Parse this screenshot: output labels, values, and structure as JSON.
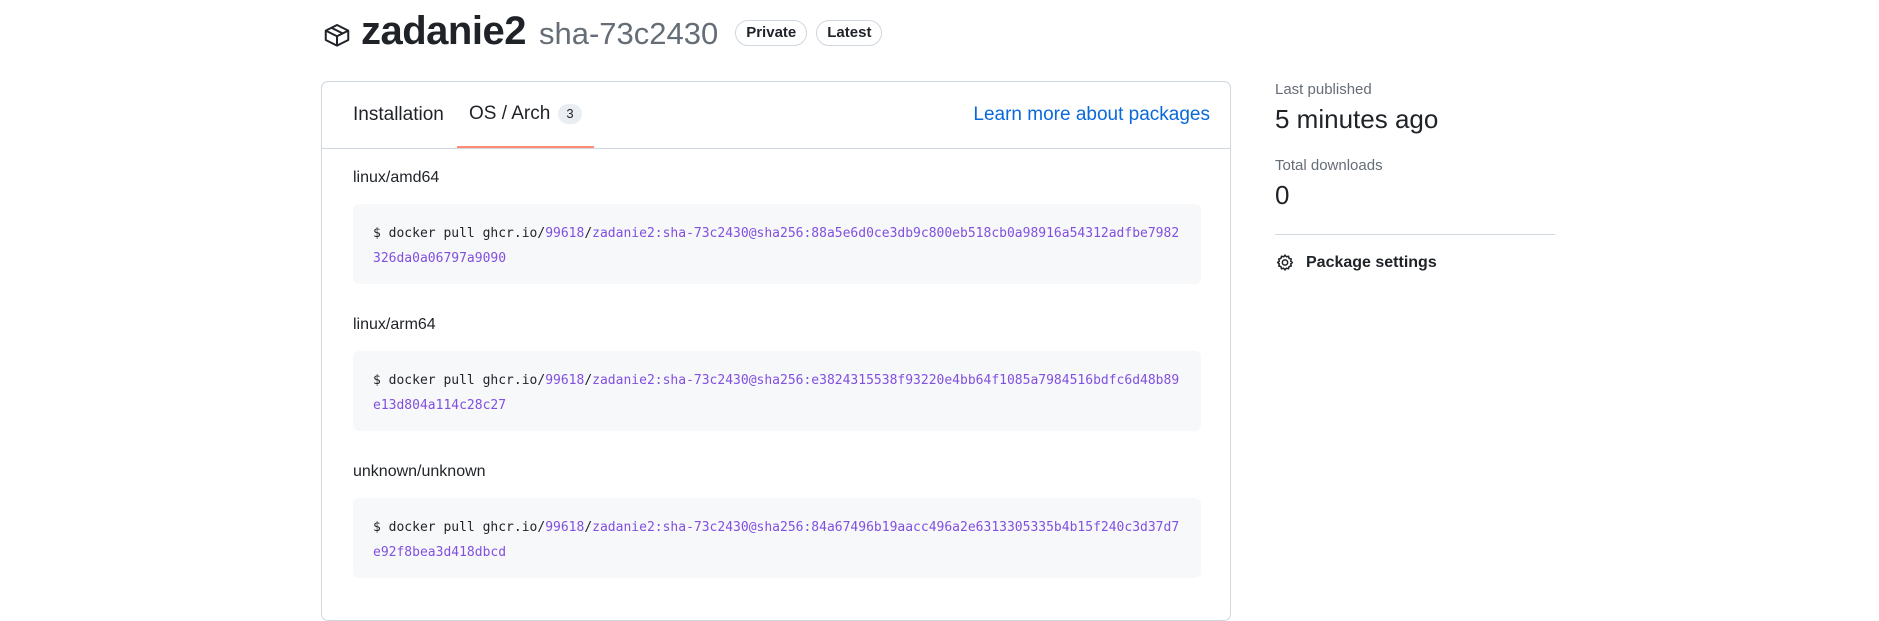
{
  "package": {
    "icon": "package-icon",
    "name": "zadanie2",
    "tag": "sha-73c2430",
    "badges": [
      "Private",
      "Latest"
    ]
  },
  "tabs": {
    "installation": "Installation",
    "os_arch": "OS / Arch",
    "os_arch_count": "3",
    "learn_more": "Learn more about packages"
  },
  "platforms": [
    {
      "label": "linux/amd64",
      "prefix": "$ docker pull ghcr.io/",
      "owner": "99618",
      "slash": "/",
      "image": "zadanie2:sha-73c2430@sha256:88a5e6d0ce3db9c800eb518cb0a98916a54312adfbe7982326da0a06797a9090"
    },
    {
      "label": "linux/arm64",
      "prefix": "$ docker pull ghcr.io/",
      "owner": "99618",
      "slash": "/",
      "image": "zadanie2:sha-73c2430@sha256:e3824315538f93220e4bb64f1085a7984516bdfc6d48b89e13d804a114c28c27"
    },
    {
      "label": "unknown/unknown",
      "prefix": "$ docker pull ghcr.io/",
      "owner": "99618",
      "slash": "/",
      "image": "zadanie2:sha-73c2430@sha256:84a67496b19aacc496a2e6313305335b4b15f240c3d37d7e92f8bea3d418dbcd"
    }
  ],
  "sidebar": {
    "last_published_label": "Last published",
    "last_published_value": "5 minutes ago",
    "total_downloads_label": "Total downloads",
    "total_downloads_value": "0",
    "settings_icon": "gear-icon",
    "settings_label": "Package settings"
  },
  "colors": {
    "accent_link": "#0969da",
    "tab_underline": "#fd8c73",
    "code_accent": "#8250df"
  }
}
